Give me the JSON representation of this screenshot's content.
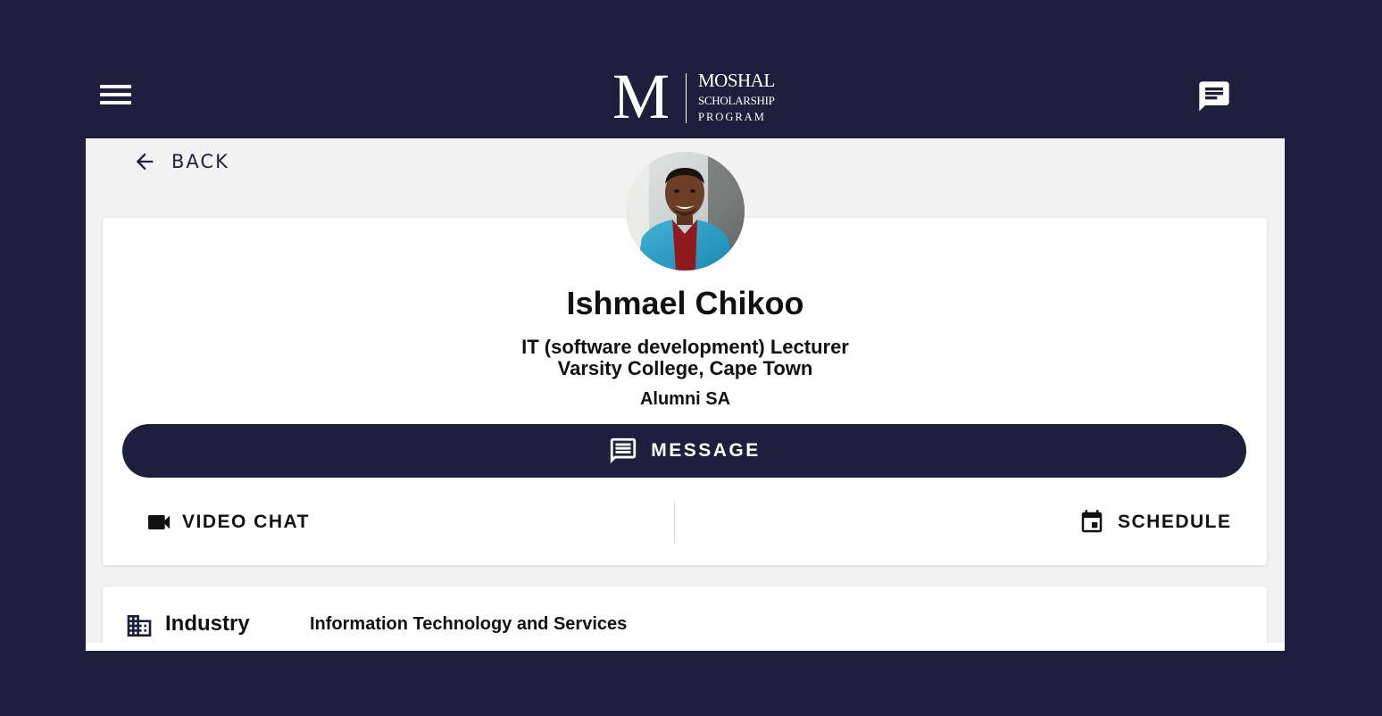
{
  "header": {
    "logo": {
      "letter": "M",
      "line1": "MOSHAL",
      "line2": "SCHOLARSHIP",
      "line3": "PROGRAM"
    },
    "menu_icon": "menu-icon",
    "chat_icon": "chat-icon"
  },
  "nav": {
    "back_label": "BACK"
  },
  "profile": {
    "name": "Ishmael Chikoo",
    "title": "IT (software development) Lecturer",
    "organization": "Varsity College, Cape Town",
    "group": "Alumni SA"
  },
  "actions": {
    "message_label": "MESSAGE",
    "video_chat_label": "VIDEO CHAT",
    "schedule_label": "SCHEDULE"
  },
  "details": {
    "industry_label": "Industry",
    "industry_value": "Information Technology and Services"
  },
  "colors": {
    "brand_navy": "#1f1e3c",
    "background": "#f2f2f2",
    "card": "#ffffff",
    "text": "#111111"
  }
}
